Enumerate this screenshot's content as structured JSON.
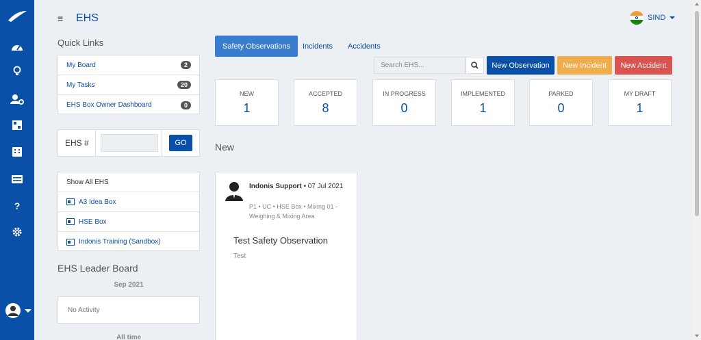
{
  "header": {
    "title": "EHS",
    "user_name": "SIND"
  },
  "sidebar": {
    "icons": [
      "speedometer-icon",
      "lightbulb-icon",
      "user-settings-icon",
      "dashboard-icon",
      "calendar-icon",
      "list-icon",
      "help-icon",
      "gear-icon"
    ],
    "help_glyph": "?"
  },
  "quick_links": {
    "title": "Quick Links",
    "items": [
      {
        "label": "My Board",
        "count": "2"
      },
      {
        "label": "My Tasks",
        "count": "20"
      },
      {
        "label": "EHS Box Owner Dashboard",
        "count": "0"
      }
    ]
  },
  "ehs_lookup": {
    "label": "EHS #",
    "input_value": "",
    "go_label": "GO"
  },
  "boxes": {
    "show_all": "Show All EHS",
    "items": [
      "A3 Idea Box",
      "HSE Box",
      "Indonis Training (Sandbox)"
    ]
  },
  "leader_board": {
    "title": "EHS Leader Board",
    "period": "Sep 2021",
    "empty_text": "No Activity",
    "period2": "All time"
  },
  "tabs": [
    {
      "label": "Safety Observations",
      "active": true
    },
    {
      "label": "Incidents",
      "active": false
    },
    {
      "label": "Accidents",
      "active": false
    }
  ],
  "search": {
    "placeholder": "Search EHS..."
  },
  "actions": [
    {
      "label": "New Observation",
      "color": "#0a4fa8"
    },
    {
      "label": "New Incident",
      "color": "#f0ad4e"
    },
    {
      "label": "New Accident",
      "color": "#d9534f"
    }
  ],
  "stats": [
    {
      "label": "NEW",
      "value": "1"
    },
    {
      "label": "ACCEPTED",
      "value": "8"
    },
    {
      "label": "IN PROGRESS",
      "value": "0"
    },
    {
      "label": "IMPLEMENTED",
      "value": "1"
    },
    {
      "label": "PARKED",
      "value": "0"
    },
    {
      "label": "MY DRAFT",
      "value": "1"
    }
  ],
  "column": {
    "heading": "New",
    "card": {
      "author": "Indonis Support",
      "date": "07 Jul 2021",
      "tags": "P1 • UC • HSE Box • Mixing 01 - Weighing & Mixing Area",
      "title": "Test Safety Observation",
      "description": "Test"
    }
  },
  "colors": {
    "primary": "#0a4fa8",
    "tab_active": "#3a7ccf",
    "warning": "#f0ad4e",
    "danger": "#d9534f",
    "background": "#eceff3"
  }
}
